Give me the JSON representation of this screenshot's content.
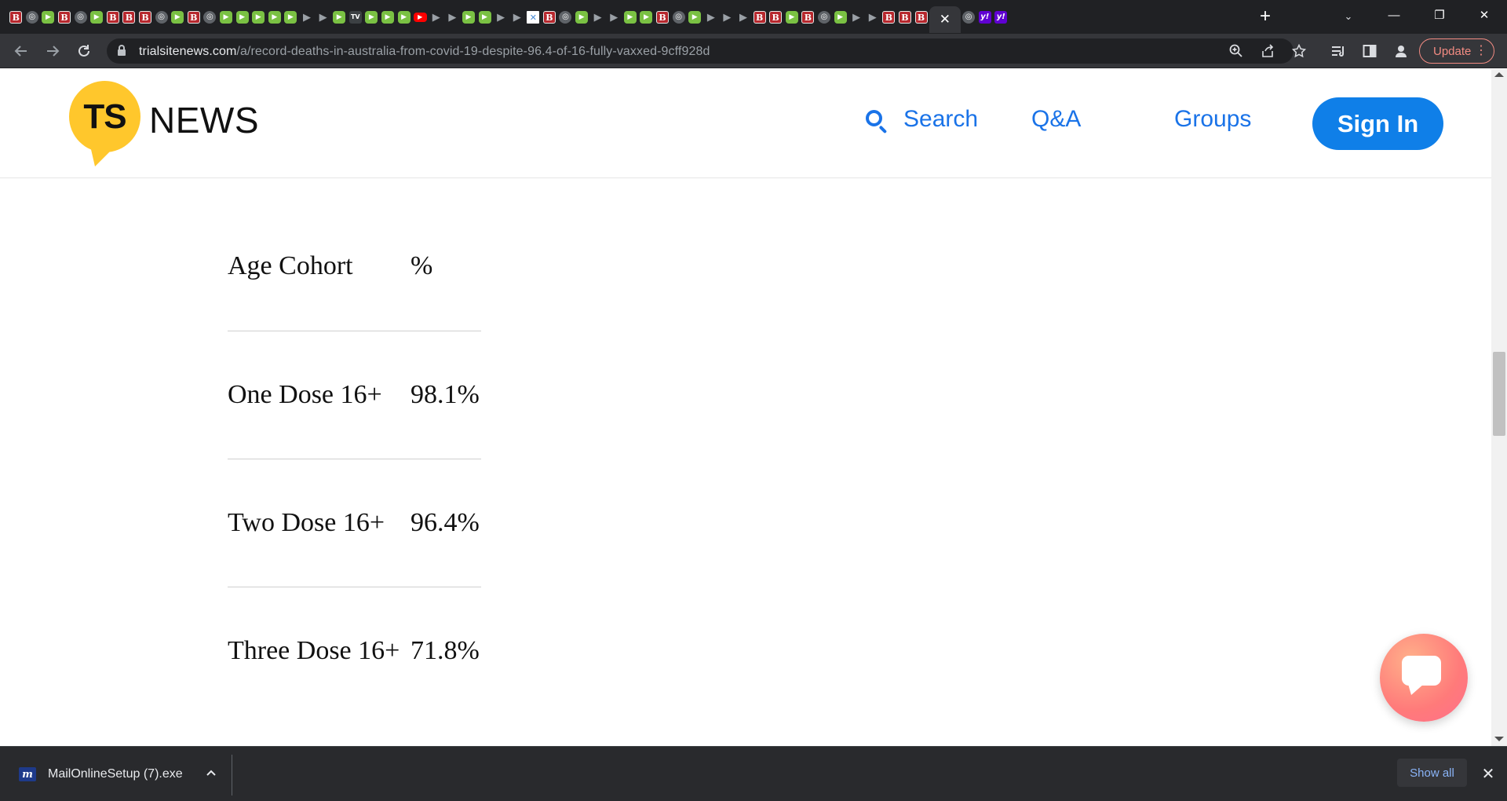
{
  "browser": {
    "active_tab_close": "✕",
    "new_tab": "+",
    "tab_search": "⌄",
    "url_host": "trialsitenews.com",
    "url_path": "/a/record-deaths-in-australia-from-covid-19-despite-96.4-of-16-fully-vaxxed-9cff928d",
    "update_label": "Update",
    "window_controls": {
      "minimize": "—",
      "restore": "❐",
      "close": "✕"
    }
  },
  "site": {
    "logo_mark": "TS",
    "logo_word": "NEWS",
    "nav": {
      "search": "Search",
      "qa": "Q&A",
      "groups": "Groups",
      "sign_in": "Sign In"
    },
    "accent_color": "#1a73e8",
    "logo_color": "#ffc72c"
  },
  "article": {
    "table": {
      "header": [
        "Age Cohort",
        "%"
      ],
      "rows": [
        [
          "One Dose 16+",
          "98.1%"
        ],
        [
          "Two Dose 16+",
          "96.4%"
        ],
        [
          "Three Dose 16+",
          "71.8%"
        ]
      ]
    }
  },
  "download_bar": {
    "file_name": "MailOnlineSetup (7).exe",
    "file_icon": "m",
    "show_all": "Show all",
    "close": "✕"
  }
}
